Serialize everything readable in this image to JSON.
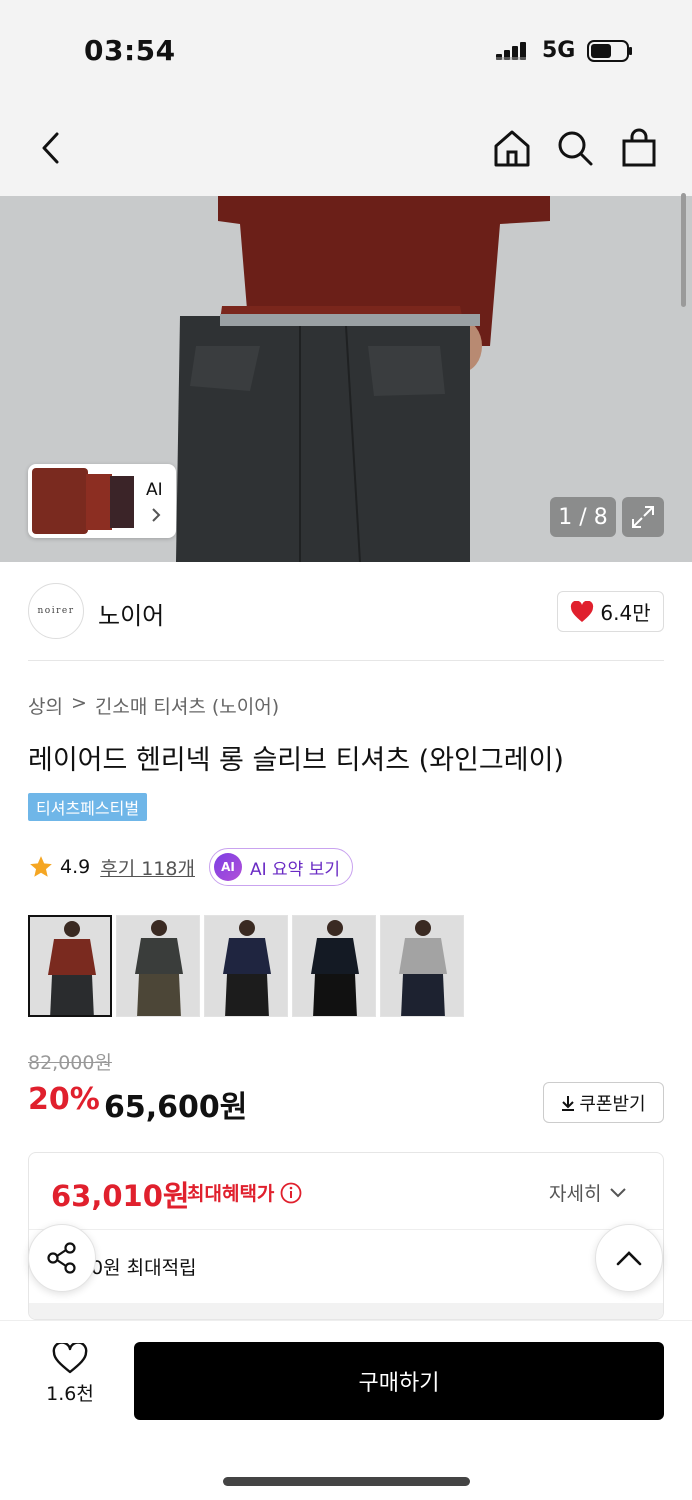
{
  "status": {
    "time": "03:54",
    "network": "5G"
  },
  "nav": {
    "icons": [
      "back-icon",
      "home-icon",
      "search-icon",
      "shopping-bag-icon"
    ]
  },
  "gallery": {
    "counter": "1 / 8",
    "ai_label": "AI"
  },
  "brand": {
    "logo_text": "noirer",
    "name": "노이어",
    "likes": "6.4만"
  },
  "breadcrumb": {
    "category": "상의",
    "separator": ">",
    "subcategory": "긴소매 티셔츠 (노이어)"
  },
  "product": {
    "title": "레이어드 헨리넥 롱 슬리브 티셔츠 (와인그레이)",
    "promo_badge": "티셔츠페스티벌",
    "rating": "4.9",
    "reviews": "후기 118개",
    "ai_summary": "AI 요약 보기",
    "ai_badge": "AI"
  },
  "colors": [
    {
      "name": "wine",
      "top": "#7a2a1f",
      "bottom": "#2a2c2e"
    },
    {
      "name": "charcoal",
      "top": "#3a3d3b",
      "bottom": "#4c4637"
    },
    {
      "name": "navy",
      "top": "#1f2540",
      "bottom": "#1c1c1c"
    },
    {
      "name": "black",
      "top": "#141a24",
      "bottom": "#111"
    },
    {
      "name": "gray",
      "top": "#a3a3a3",
      "bottom": "#1d2230"
    }
  ],
  "price": {
    "original": "82,000원",
    "discount": "20%",
    "sale": "65,600원",
    "coupon": "쿠폰받기"
  },
  "benefit": {
    "max_price": "63,010원",
    "max_label": "최대혜택가",
    "detail": "자세히",
    "points": "0원 최대적립"
  },
  "bottom": {
    "wish_count": "1.6천",
    "buy": "구매하기"
  },
  "colors_theme": {
    "accent_red": "#e0202d",
    "badge_blue": "#6fb6e8",
    "ai_purple": "#7b3fe4"
  }
}
